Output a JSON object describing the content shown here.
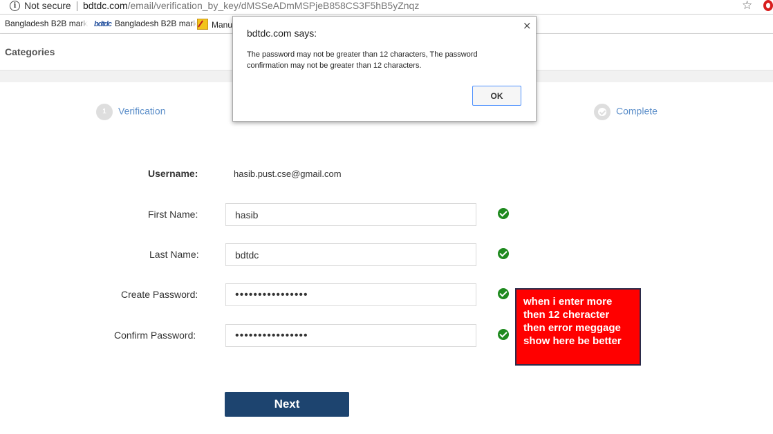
{
  "browser": {
    "security_label": "Not secure",
    "url_host": "bdtdc.com",
    "url_path": "/email/verification_by_key/dMSSeADmMSPjeB858CS3F5hB5yZnqz",
    "bookmarks": [
      {
        "label": "Bangladesh B2B mark"
      },
      {
        "label": "Bangladesh B2B mark"
      },
      {
        "label": "Manu"
      }
    ]
  },
  "header": {
    "categories_label": "Categories"
  },
  "steps": [
    {
      "number": "1",
      "label": "Verification"
    },
    {
      "label": "Complete"
    }
  ],
  "form": {
    "username_label": "Username:",
    "username_value": "hasib.pust.cse@gmail.com",
    "first_name_label": "First Name:",
    "first_name_value": "hasib",
    "last_name_label": "Last Name:",
    "last_name_value": "bdtdc",
    "create_password_label": "Create Password:",
    "create_password_value": "••••••••••••••••",
    "confirm_password_label": "Confirm Password:",
    "confirm_password_value": "••••••••••••••••",
    "next_label": "Next"
  },
  "annotation": {
    "text": "when i enter more then 12 cheracter then error meggage show here be better"
  },
  "dialog": {
    "title": "bdtdc.com says:",
    "close_glyph": "×",
    "message": "The password may not be greater than 12 characters, The password confirmation may not be greater than 12 characters.",
    "ok_label": "OK"
  },
  "colors": {
    "primary_button": "#1d446f",
    "step_link": "#5b8ec9",
    "valid_check": "#1f8a1f",
    "annotation_bg": "#ff0000"
  }
}
